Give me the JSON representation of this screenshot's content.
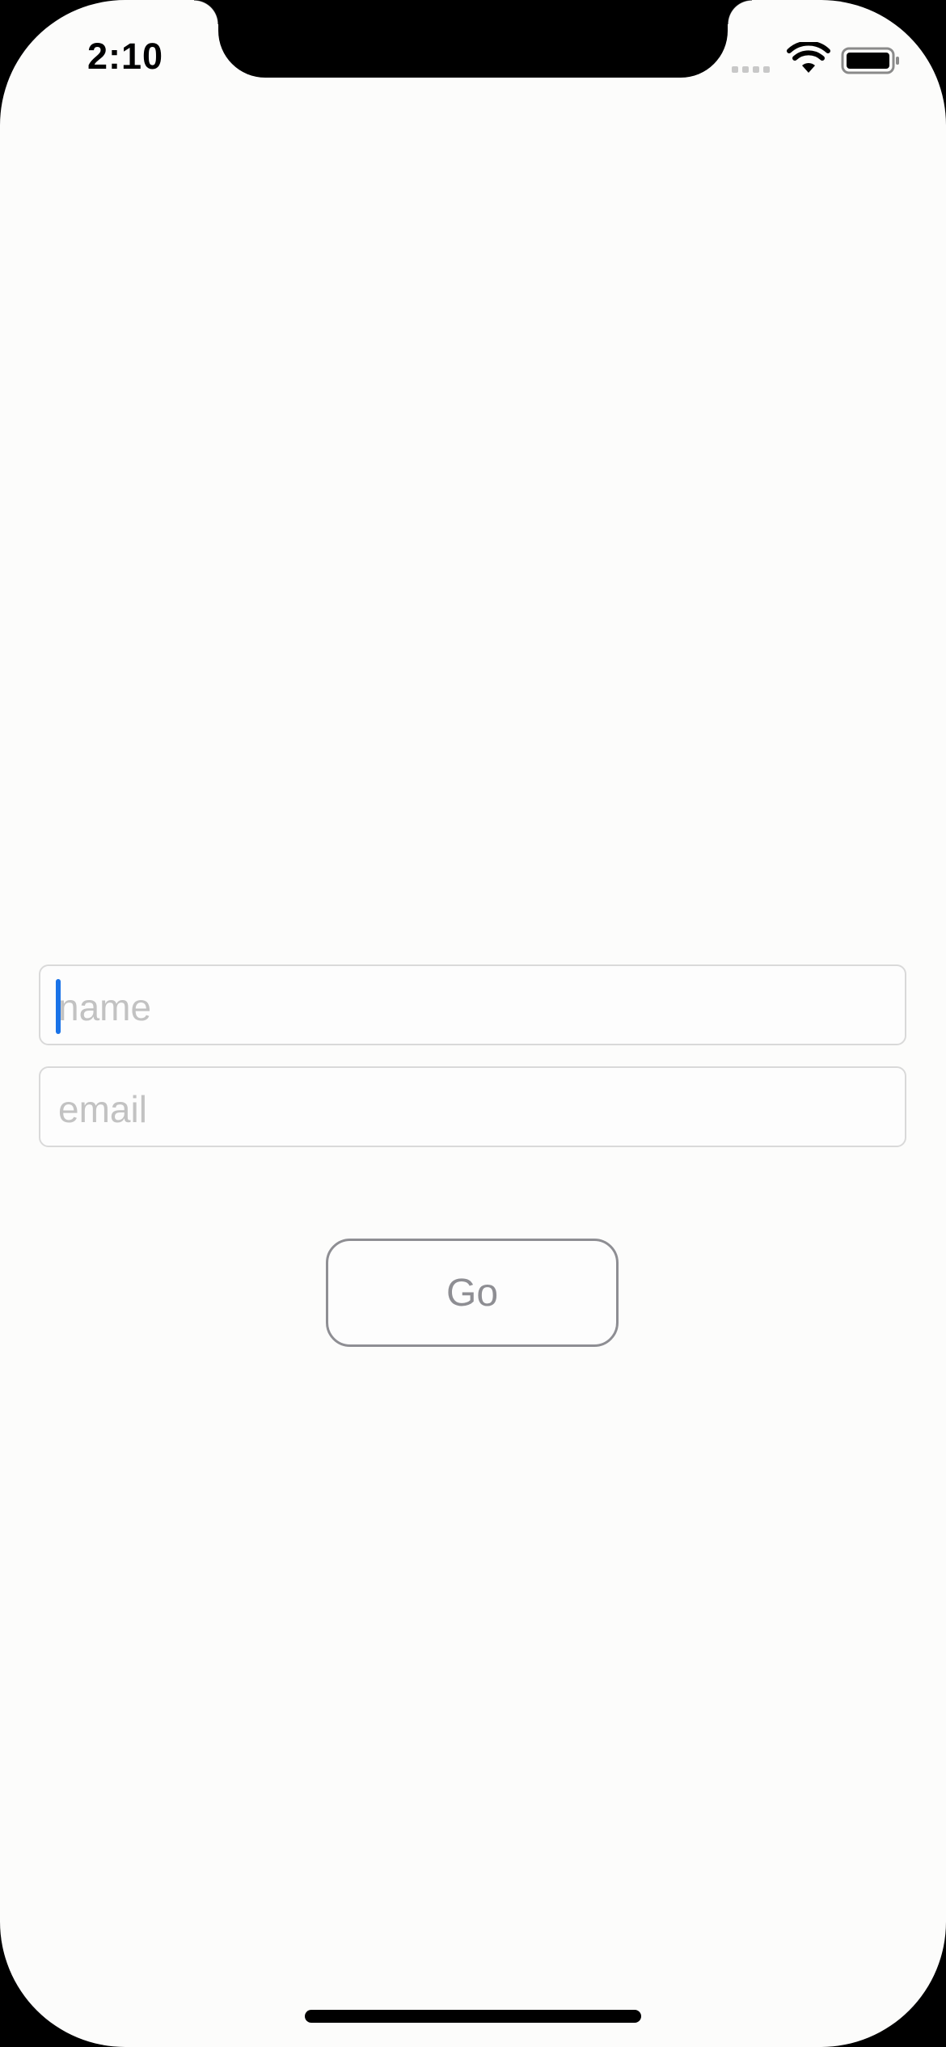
{
  "status_bar": {
    "time": "2:10"
  },
  "form": {
    "name_field": {
      "value": "",
      "placeholder": "name",
      "focused": true
    },
    "email_field": {
      "value": "",
      "placeholder": "email"
    },
    "go_button": {
      "label": "Go"
    }
  },
  "icons": {
    "wifi": "wifi-icon",
    "battery": "battery-icon",
    "signal": "cellular-signal-icon"
  },
  "colors": {
    "background": "#fcfcfb",
    "cursor": "#1a73e8",
    "placeholder": "#c2c2c2",
    "button_text": "#8e8e93",
    "button_border": "#8e8e93",
    "field_border": "#d9d9d9"
  }
}
